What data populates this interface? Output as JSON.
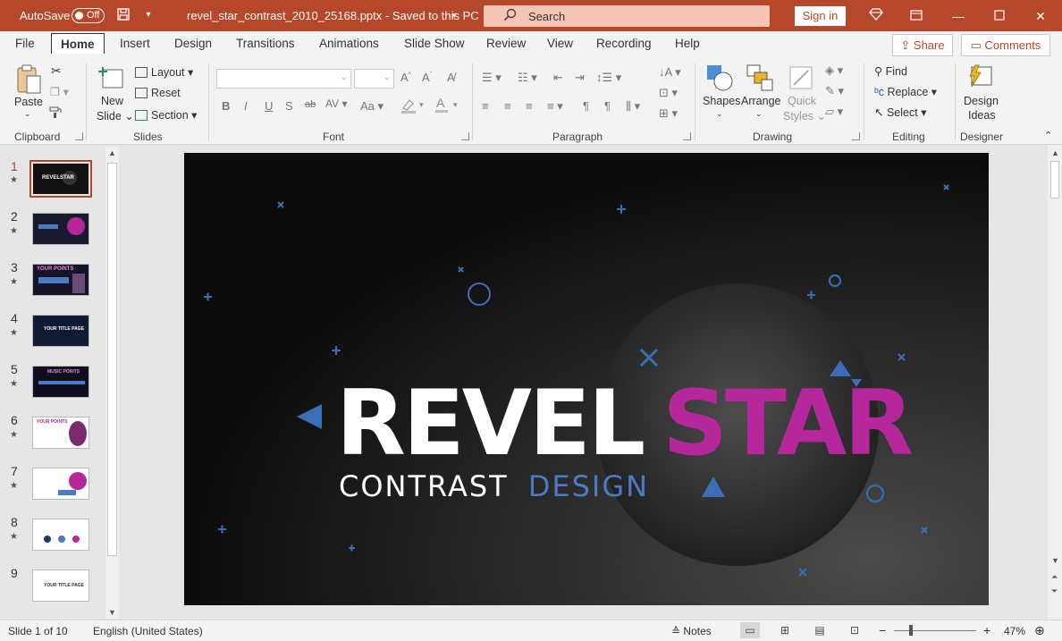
{
  "titlebar": {
    "autosave_label": "AutoSave",
    "autosave_state": "Off",
    "file_title": "revel_star_contrast_2010_25168.pptx  -  Saved to this PC",
    "search_placeholder": "Search",
    "signin_label": "Sign in"
  },
  "tabs": {
    "file": "File",
    "home": "Home",
    "insert": "Insert",
    "design": "Design",
    "transitions": "Transitions",
    "animations": "Animations",
    "slideshow": "Slide Show",
    "review": "Review",
    "view": "View",
    "recording": "Recording",
    "help": "Help",
    "share": "Share",
    "comments": "Comments"
  },
  "ribbon": {
    "clipboard": {
      "label": "Clipboard",
      "paste": "Paste"
    },
    "slides": {
      "label": "Slides",
      "new_slide_1": "New",
      "new_slide_2": "Slide",
      "layout": "Layout",
      "reset": "Reset",
      "section": "Section"
    },
    "font": {
      "label": "Font",
      "bold": "B",
      "italic": "I",
      "underline": "U",
      "shadow": "S",
      "strike": "ab",
      "spacing": "AV",
      "case": "Aa"
    },
    "paragraph": {
      "label": "Paragraph"
    },
    "drawing": {
      "label": "Drawing",
      "shapes": "Shapes",
      "arrange": "Arrange",
      "quick_styles_1": "Quick",
      "quick_styles_2": "Styles"
    },
    "editing": {
      "label": "Editing",
      "find": "Find",
      "replace": "Replace",
      "select": "Select"
    },
    "designer": {
      "label": "Designer",
      "design_ideas_1": "Design",
      "design_ideas_2": "Ideas"
    }
  },
  "thumbnails": [
    {
      "num": "1",
      "title": "REVELSTAR"
    },
    {
      "num": "2",
      "title": ""
    },
    {
      "num": "3",
      "title": "YOUR POINTS"
    },
    {
      "num": "4",
      "title": "YOUR TITLE PAGE"
    },
    {
      "num": "5",
      "title": "MUSIC POINTS"
    },
    {
      "num": "6",
      "title": "YOUR POINTS"
    },
    {
      "num": "7",
      "title": ""
    },
    {
      "num": "8",
      "title": ""
    },
    {
      "num": "9",
      "title": "YOUR TITLE PAGE"
    }
  ],
  "slide": {
    "title_white": "REVEL",
    "title_pink": "STAR",
    "subtitle_white": "CONTRAST",
    "subtitle_blue": "DESIGN",
    "colors": {
      "pink": "#b5279b",
      "blue": "#4a7cc6",
      "white": "#ffffff"
    }
  },
  "statusbar": {
    "slide_info": "Slide 1 of 10",
    "language": "English (United States)",
    "notes": "Notes",
    "zoom": "47%"
  }
}
